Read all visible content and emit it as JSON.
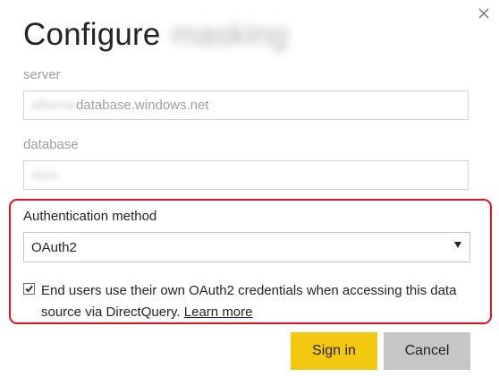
{
  "dialog": {
    "title": "Configure",
    "title_redacted": "masking",
    "close_icon": "close-icon"
  },
  "server": {
    "label": "server",
    "value_redacted": "athome",
    "value_suffix": "database.windows.net"
  },
  "database": {
    "label": "database",
    "value_redacted": "sqra"
  },
  "auth": {
    "label": "Authentication method",
    "selected": "OAuth2",
    "dropdown_icon": "chevron-down-icon",
    "checkbox_checked": true,
    "checkbox_text": "End users use their own OAuth2 credentials when accessing this data source via DirectQuery.",
    "learn_more": "Learn more",
    "highlight_color": "#e81123"
  },
  "buttons": {
    "sign_in": "Sign in",
    "cancel": "Cancel",
    "sign_in_color": "#f2c811",
    "cancel_color": "#c8c6c4"
  }
}
